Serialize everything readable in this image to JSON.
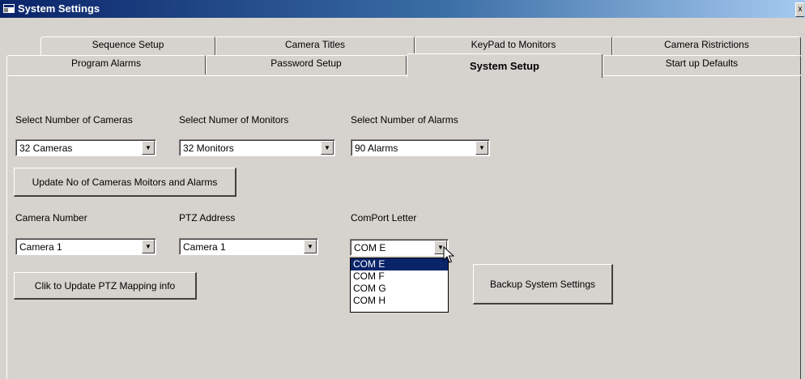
{
  "window": {
    "title": "System Settings",
    "close_glyph": "x"
  },
  "tabs": {
    "row1": [
      "Sequence Setup",
      "Camera Titles",
      "KeyPad to Monitors",
      "Camera Ristrictions"
    ],
    "row2": [
      "Program Alarms",
      "Password Setup",
      "System Setup",
      "Start up Defaults"
    ],
    "active": "System Setup"
  },
  "form": {
    "cameras_label": "Select Number of Cameras",
    "cameras_value": "32  Cameras",
    "monitors_label": "Select Numer of Monitors",
    "monitors_value": "32 Monitors",
    "alarms_label": "Select Number of Alarms",
    "alarms_value": "90  Alarms",
    "update_button": "Update No of Cameras Moitors and Alarms",
    "camera_number_label": "Camera Number",
    "camera_number_value": "Camera 1",
    "ptz_address_label": "PTZ Address",
    "ptz_address_value": "Camera 1",
    "comport_label": "ComPort Letter",
    "comport_value": "COM E",
    "comport_options": [
      "COM E",
      "COM F",
      "COM G",
      "COM H"
    ],
    "comport_selected": "COM E",
    "ptz_button": "Clik to Update PTZ Mapping info",
    "backup_button": "Backup System Settings"
  },
  "icons": {
    "app": "window-app-icon",
    "dropdown": "chevron-down-icon",
    "cursor": "mouse-pointer-icon"
  },
  "colors": {
    "titlebar_start": "#0a246a",
    "titlebar_end": "#a6caf0",
    "face": "#d6d3ce",
    "selection": "#0a246a"
  }
}
